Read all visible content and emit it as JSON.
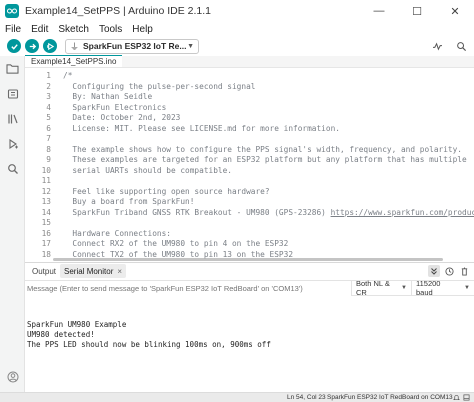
{
  "window": {
    "title": "Example14_SetPPS | Arduino IDE 2.1.1",
    "minimize_glyph": "—",
    "maximize_glyph": "☐",
    "close_glyph": "✕"
  },
  "menu": [
    "File",
    "Edit",
    "Sketch",
    "Tools",
    "Help"
  ],
  "toolbar": {
    "board": "SparkFun ESP32 IoT Re...",
    "accent_color": "#00979c"
  },
  "editor": {
    "tab_label": "Example14_SetPPS.ino",
    "lines": [
      {
        "n": "1",
        "text": "/*"
      },
      {
        "n": "2",
        "text": "  Configuring the pulse-per-second signal"
      },
      {
        "n": "3",
        "text": "  By: Nathan Seidle"
      },
      {
        "n": "4",
        "text": "  SparkFun Electronics"
      },
      {
        "n": "5",
        "text": "  Date: October 2nd, 2023"
      },
      {
        "n": "6",
        "text": "  License: MIT. Please see LICENSE.md for more information."
      },
      {
        "n": "7",
        "text": ""
      },
      {
        "n": "8",
        "text": "  The example shows how to configure the PPS signal's width, frequency, and polarity."
      },
      {
        "n": "9",
        "text": "  These examples are targeted for an ESP32 platform but any platform that has multiple"
      },
      {
        "n": "10",
        "text": "  serial UARTs should be compatible."
      },
      {
        "n": "11",
        "text": ""
      },
      {
        "n": "12",
        "text": "  Feel like supporting open source hardware?"
      },
      {
        "n": "13",
        "text": "  Buy a board from SparkFun!"
      },
      {
        "n": "14",
        "text": "  SparkFun Triband GNSS RTK Breakout - UM980 (GPS-23286) ",
        "link": "https://www.sparkfun.com/products/2328"
      },
      {
        "n": "15",
        "text": ""
      },
      {
        "n": "16",
        "text": "  Hardware Connections:"
      },
      {
        "n": "17",
        "text": "  Connect RX2 of the UM980 to pin 4 on the ESP32"
      },
      {
        "n": "18",
        "text": "  Connect TX2 of the UM980 to pin 13 on the ESP32"
      }
    ]
  },
  "panel": {
    "tabs": [
      "Output",
      "Serial Monitor"
    ],
    "close_glyph": "×",
    "input_placeholder": "Message (Enter to send message to 'SparkFun ESP32 IoT RedBoard' on 'COM13')",
    "line_ending": "Both NL & CR",
    "baud": "115200 baud",
    "output": [
      "SparkFun UM980 Example",
      "UM980 detected!",
      "The PPS LED should now be blinking 100ms on, 900ms off"
    ]
  },
  "status": {
    "position": "Ln 54, Col 23",
    "board": "SparkFun ESP32 IoT RedBoard on COM13"
  }
}
